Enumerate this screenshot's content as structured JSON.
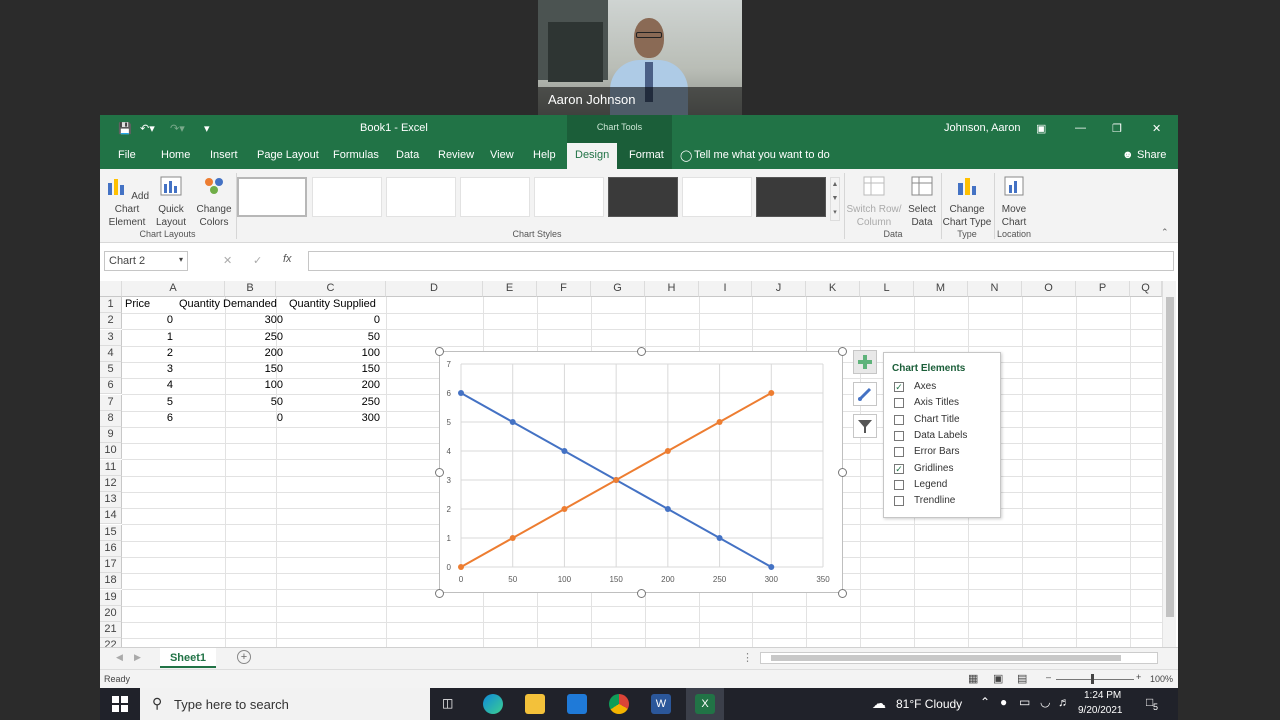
{
  "webcam": {
    "name": "Aaron Johnson"
  },
  "window": {
    "title": "Book1 - Excel",
    "context_label": "Chart Tools",
    "user": "Johnson, Aaron"
  },
  "tabs": [
    {
      "label": "File"
    },
    {
      "label": "Home"
    },
    {
      "label": "Insert"
    },
    {
      "label": "Page Layout"
    },
    {
      "label": "Formulas"
    },
    {
      "label": "Data"
    },
    {
      "label": "Review"
    },
    {
      "label": "View"
    },
    {
      "label": "Help"
    },
    {
      "label": "Design"
    },
    {
      "label": "Format"
    }
  ],
  "tell_me": "Tell me what you want to do",
  "share": "Share",
  "ribbon": {
    "add_chart_element": "Add Chart Element",
    "quick_layout": "Quick Layout",
    "change_colors": "Change Colors",
    "group_chart_layouts": "Chart Layouts",
    "group_chart_styles": "Chart Styles",
    "switch_row_column": "Switch Row/ Column",
    "select_data": "Select Data",
    "group_data": "Data",
    "change_chart_type": "Change Chart Type",
    "group_type": "Type",
    "move_chart": "Move Chart",
    "group_location": "Location"
  },
  "formula_bar": {
    "name_box": "Chart 2",
    "fx": "fx",
    "value": ""
  },
  "columns": [
    "A",
    "B",
    "C",
    "D",
    "E",
    "F",
    "G",
    "H",
    "I",
    "J",
    "K",
    "L",
    "M",
    "N",
    "O",
    "P",
    "Q"
  ],
  "rows": [
    "1",
    "2",
    "3",
    "4",
    "5",
    "6",
    "7",
    "8",
    "9",
    "10",
    "11",
    "12",
    "13",
    "14",
    "15",
    "16",
    "17",
    "18",
    "19",
    "20",
    "21",
    "22"
  ],
  "table": {
    "headers": [
      "Price",
      "Quantity Demanded",
      "Quantity Supplied"
    ],
    "rows": [
      [
        "0",
        "300",
        "0"
      ],
      [
        "1",
        "250",
        "50"
      ],
      [
        "2",
        "200",
        "100"
      ],
      [
        "3",
        "150",
        "150"
      ],
      [
        "4",
        "100",
        "200"
      ],
      [
        "5",
        "50",
        "250"
      ],
      [
        "6",
        "0",
        "300"
      ]
    ]
  },
  "chart_data": {
    "type": "scatter",
    "x_ticks": [
      "0",
      "50",
      "100",
      "150",
      "200",
      "250",
      "300",
      "350"
    ],
    "y_ticks": [
      "0",
      "1",
      "2",
      "3",
      "4",
      "5",
      "6",
      "7"
    ],
    "xlim": [
      0,
      350
    ],
    "ylim": [
      0,
      7
    ],
    "grid": true,
    "series": [
      {
        "color": "#4472c4",
        "points": [
          [
            300,
            0
          ],
          [
            250,
            1
          ],
          [
            200,
            2
          ],
          [
            150,
            3
          ],
          [
            100,
            4
          ],
          [
            50,
            5
          ],
          [
            0,
            6
          ]
        ]
      },
      {
        "color": "#ed7d31",
        "points": [
          [
            0,
            0
          ],
          [
            50,
            1
          ],
          [
            100,
            2
          ],
          [
            150,
            3
          ],
          [
            200,
            4
          ],
          [
            250,
            5
          ],
          [
            300,
            6
          ]
        ]
      }
    ]
  },
  "chart_elements": {
    "title": "Chart Elements",
    "items": [
      {
        "label": "Axes",
        "checked": true
      },
      {
        "label": "Axis Titles",
        "checked": false
      },
      {
        "label": "Chart Title",
        "checked": false
      },
      {
        "label": "Data Labels",
        "checked": false
      },
      {
        "label": "Error Bars",
        "checked": false
      },
      {
        "label": "Gridlines",
        "checked": true
      },
      {
        "label": "Legend",
        "checked": false
      },
      {
        "label": "Trendline",
        "checked": false
      }
    ]
  },
  "sheet_tab": "Sheet1",
  "status": {
    "ready": "Ready",
    "zoom": "100%"
  },
  "taskbar": {
    "search_placeholder": "Type here to search",
    "weather": "81°F  Cloudy",
    "time": "1:24 PM",
    "date": "9/20/2021",
    "notifications": "5"
  }
}
